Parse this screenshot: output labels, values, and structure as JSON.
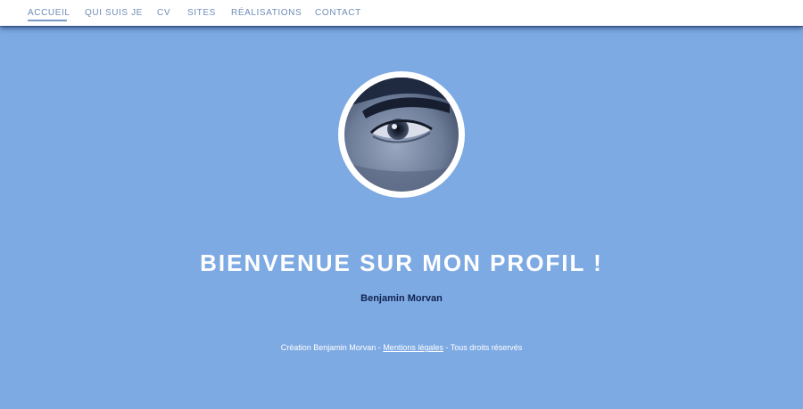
{
  "nav": {
    "items": [
      {
        "label": "ACCUEIL"
      },
      {
        "label": "QUI SUIS JE"
      },
      {
        "label": "CV"
      },
      {
        "label": "SITES"
      },
      {
        "label": "RÉALISATIONS"
      },
      {
        "label": "CONTACT"
      }
    ],
    "active_index": 0
  },
  "hero": {
    "title": "BIENVENUE SUR MON PROFIL !",
    "name": "Benjamin Morvan"
  },
  "footer": {
    "prefix": "Création Benjamin Morvan - ",
    "link_label": "Mentions légales",
    "suffix": " - Tous droits réservés"
  },
  "colors": {
    "background": "#7eaae3",
    "nav_text": "#6f8db8",
    "name_text": "#0f2350"
  }
}
